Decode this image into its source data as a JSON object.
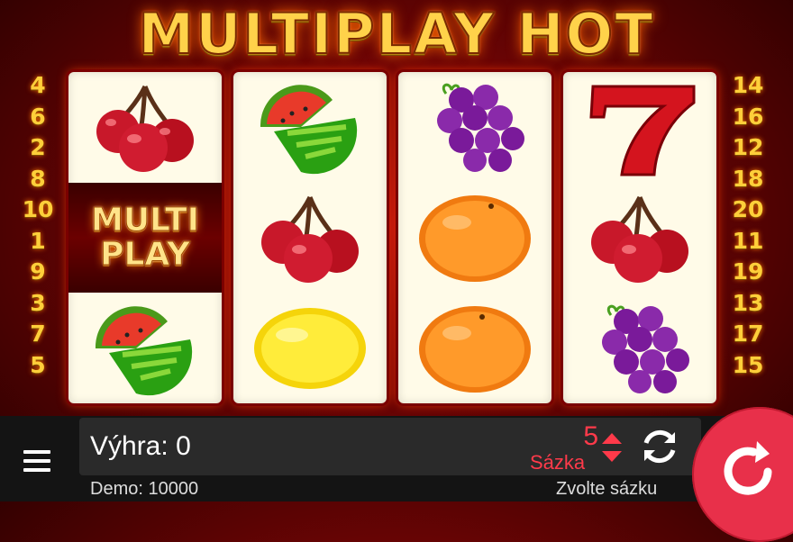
{
  "game": {
    "title": "MULTIPLAY HOT"
  },
  "paylines": {
    "left": [
      "4",
      "6",
      "2",
      "8",
      "10",
      "1",
      "9",
      "3",
      "7",
      "5"
    ],
    "right": [
      "14",
      "16",
      "12",
      "18",
      "20",
      "11",
      "19",
      "13",
      "17",
      "15"
    ]
  },
  "reels": [
    [
      "cherries",
      "multiplay",
      "watermelon"
    ],
    [
      "watermelon",
      "cherries",
      "lemon"
    ],
    [
      "grapes",
      "orange",
      "orange"
    ],
    [
      "seven",
      "cherries",
      "grapes"
    ]
  ],
  "multiplay_symbol": {
    "line1": "MULTI",
    "line2": "PLAY"
  },
  "footer": {
    "win_label": "Výhra:",
    "win_value": "0",
    "bet_value": "5",
    "bet_label": "Sázka",
    "demo_label": "Demo:",
    "demo_value": "10000",
    "choose_bet": "Zvolte sázku"
  },
  "icons": {
    "menu": "hamburger-icon",
    "bet_stepper": "up-down-arrows-icon",
    "autoplay": "refresh-icon",
    "spin": "spin-arrow-icon"
  },
  "colors": {
    "accent": "#e8304a",
    "bet_text": "#ff3a4a",
    "title_gold": "#ffd24a",
    "background_red": "#8a0606"
  }
}
